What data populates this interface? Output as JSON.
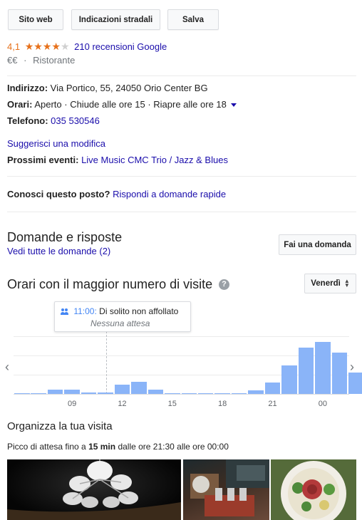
{
  "buttons": {
    "website": "Sito web",
    "directions": "Indicazioni stradali",
    "save": "Salva"
  },
  "rating": {
    "score": "4,1",
    "stars_filled": 4,
    "stars_total": 5,
    "reviews": "210 recensioni Google"
  },
  "category": {
    "price": "€€",
    "separator": "·",
    "type": "Ristorante"
  },
  "info": {
    "address_label": "Indirizzo:",
    "address_value": "Via Portico, 55, 24050 Orio Center BG",
    "hours_label": "Orari:",
    "hours_status": "Aperto",
    "hours_detail": "· Chiude alle ore 15 · Riapre alle ore 18",
    "phone_label": "Telefono:",
    "phone_value": "035 530546",
    "suggest_edit": "Suggerisci una modifica",
    "events_label": "Prossimi eventi:",
    "events_value": "Live Music CMC Trio / Jazz & Blues"
  },
  "know_place": {
    "question": "Conosci questo posto?",
    "link": "Rispondi a domande rapide"
  },
  "qa": {
    "title": "Domande e risposte",
    "link": "Vedi tutte le domande (2)",
    "button": "Fai una domanda"
  },
  "popular_times": {
    "title": "Orari con il maggior numero di visite",
    "day": "Venerdì",
    "tooltip_time": "11:00:",
    "tooltip_text": "Di solito non affollato",
    "tooltip_sub": "Nessuna attesa"
  },
  "chart_data": {
    "type": "bar",
    "tick_labels": [
      "09",
      "12",
      "15",
      "18",
      "21",
      "00"
    ],
    "values": [
      0,
      0,
      0.08,
      0.08,
      0.03,
      0.03,
      0.16,
      0.21,
      0.07,
      0,
      0,
      0,
      0,
      0,
      0.06,
      0.2,
      0.5,
      0.81,
      0.91,
      0.72,
      0.38
    ],
    "ylim": [
      0,
      1
    ]
  },
  "plan": {
    "title": "Organizza la tua visita",
    "wait_prefix": "Picco di attesa fino a",
    "wait_value": "15 min",
    "wait_suffix": "dalle ore 21:30 alle ore 00:00"
  },
  "colors": {
    "link": "#1a0dab",
    "star": "#e7711b",
    "bar": "#8ab4f8",
    "accent": "#4285f4"
  }
}
